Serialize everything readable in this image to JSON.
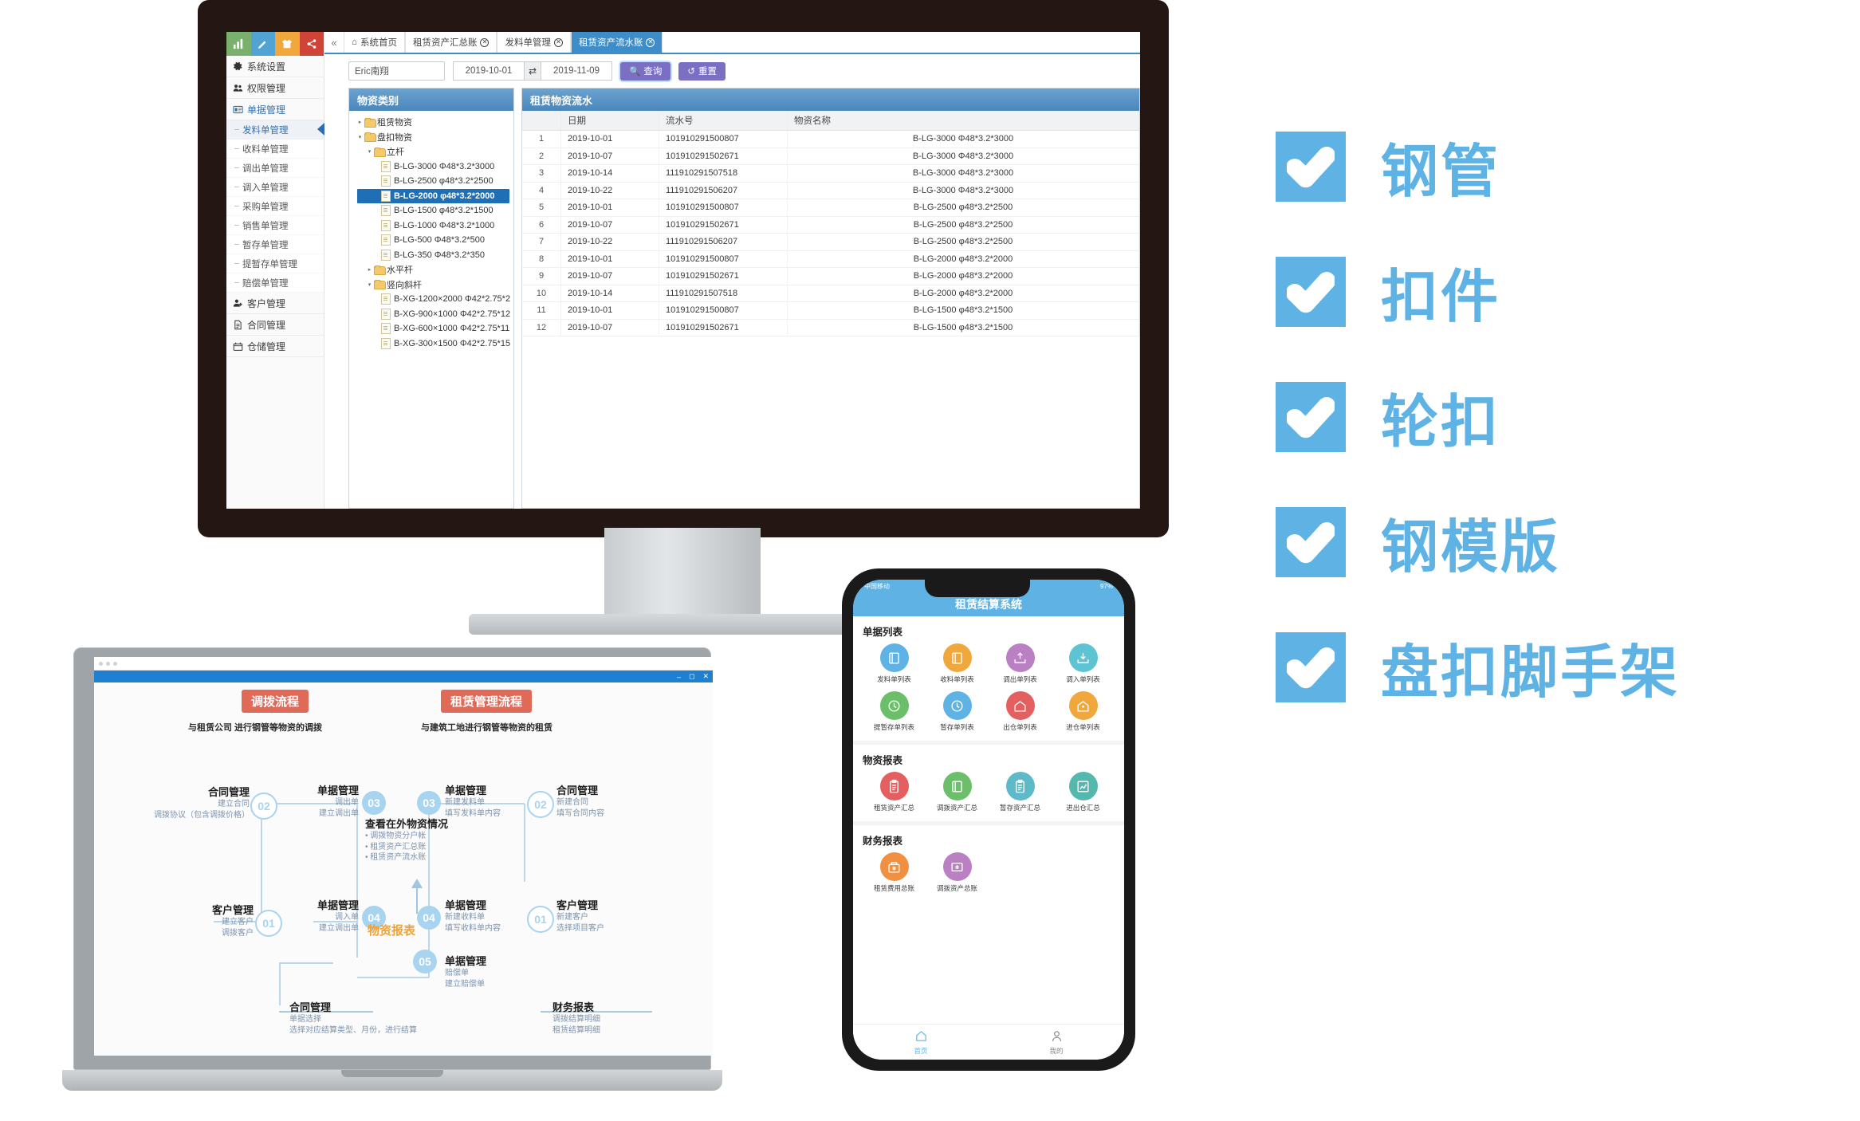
{
  "desktop": {
    "sidebar": {
      "tiles": [
        "chart-icon",
        "pencil-icon",
        "shirt-icon",
        "share-icon"
      ],
      "top_items": [
        {
          "label": "系统设置",
          "icon": "gear-icon"
        },
        {
          "label": "权限管理",
          "icon": "users-icon"
        },
        {
          "label": "单据管理",
          "icon": "card-icon",
          "active": true
        }
      ],
      "sub_items": [
        {
          "label": "发料单管理",
          "selected": true
        },
        {
          "label": "收料单管理"
        },
        {
          "label": "调出单管理"
        },
        {
          "label": "调入单管理"
        },
        {
          "label": "采购单管理"
        },
        {
          "label": "销售单管理"
        },
        {
          "label": "暂存单管理"
        },
        {
          "label": "提暂存单管理"
        },
        {
          "label": "赔偿单管理"
        }
      ],
      "bottom_items": [
        {
          "label": "客户管理",
          "icon": "user-add-icon"
        },
        {
          "label": "合同管理",
          "icon": "document-icon"
        },
        {
          "label": "仓储管理",
          "icon": "warehouse-icon"
        }
      ]
    },
    "tabs": {
      "collapse_icon": "double-chevron-left-icon",
      "items": [
        {
          "label": "系统首页",
          "icon": "home-icon",
          "closable": false,
          "active": false
        },
        {
          "label": "租赁资产汇总账",
          "closable": true,
          "active": false
        },
        {
          "label": "发料单管理",
          "closable": true,
          "active": false
        },
        {
          "label": "租赁资产流水账",
          "closable": true,
          "active": true
        }
      ]
    },
    "filters": {
      "customer_value": "Eric南翔",
      "customer_placeholder": "Eric南翔",
      "date_from": "2019-10-01",
      "swap_icon": "swap-icon",
      "date_to": "2019-11-09",
      "query_label": "查询",
      "query_icon": "search-icon",
      "reset_label": "重置",
      "reset_icon": "refresh-icon"
    },
    "tree_panel": {
      "title": "物资类别",
      "nodes": [
        {
          "label": "租赁物资",
          "type": "folder",
          "depth": 0,
          "state": "collapsed"
        },
        {
          "label": "盘扣物资",
          "type": "folder",
          "depth": 0,
          "state": "expanded"
        },
        {
          "label": "立杆",
          "type": "folder",
          "depth": 1,
          "state": "expanded"
        },
        {
          "label": "B-LG-3000 Φ48*3.2*3000",
          "type": "file",
          "depth": 2
        },
        {
          "label": "B-LG-2500 φ48*3.2*2500",
          "type": "file",
          "depth": 2
        },
        {
          "label": "B-LG-2000 φ48*3.2*2000",
          "type": "file",
          "depth": 2,
          "selected": true
        },
        {
          "label": "B-LG-1500 φ48*3.2*1500",
          "type": "file",
          "depth": 2
        },
        {
          "label": "B-LG-1000 Φ48*3.2*1000",
          "type": "file",
          "depth": 2
        },
        {
          "label": "B-LG-500 Φ48*3.2*500",
          "type": "file",
          "depth": 2
        },
        {
          "label": "B-LG-350 Φ48*3.2*350",
          "type": "file",
          "depth": 2
        },
        {
          "label": "水平杆",
          "type": "folder",
          "depth": 1,
          "state": "collapsed"
        },
        {
          "label": "竖向斜杆",
          "type": "folder",
          "depth": 1,
          "state": "expanded"
        },
        {
          "label": "B-XG-1200×2000 Φ42*2.75*2",
          "type": "file",
          "depth": 2
        },
        {
          "label": "B-XG-900×1000 Φ42*2.75*12",
          "type": "file",
          "depth": 2
        },
        {
          "label": "B-XG-600×1000 Φ42*2.75*11",
          "type": "file",
          "depth": 2
        },
        {
          "label": "B-XG-300×1500 Φ42*2.75*15",
          "type": "file",
          "depth": 2
        }
      ]
    },
    "table_panel": {
      "title": "租赁物资流水",
      "columns": [
        "",
        "日期",
        "流水号",
        "物资名称"
      ],
      "rows": [
        [
          "1",
          "2019-10-01",
          "101910291500807",
          "B-LG-3000 Φ48*3.2*3000"
        ],
        [
          "2",
          "2019-10-07",
          "101910291502671",
          "B-LG-3000 Φ48*3.2*3000"
        ],
        [
          "3",
          "2019-10-14",
          "111910291507518",
          "B-LG-3000 Φ48*3.2*3000"
        ],
        [
          "4",
          "2019-10-22",
          "111910291506207",
          "B-LG-3000 Φ48*3.2*3000"
        ],
        [
          "5",
          "2019-10-01",
          "101910291500807",
          "B-LG-2500 φ48*3.2*2500"
        ],
        [
          "6",
          "2019-10-07",
          "101910291502671",
          "B-LG-2500 φ48*3.2*2500"
        ],
        [
          "7",
          "2019-10-22",
          "111910291506207",
          "B-LG-2500 φ48*3.2*2500"
        ],
        [
          "8",
          "2019-10-01",
          "101910291500807",
          "B-LG-2000 φ48*3.2*2000"
        ],
        [
          "9",
          "2019-10-07",
          "101910291502671",
          "B-LG-2000 φ48*3.2*2000"
        ],
        [
          "10",
          "2019-10-14",
          "111910291507518",
          "B-LG-2000 φ48*3.2*2000"
        ],
        [
          "11",
          "2019-10-01",
          "101910291500807",
          "B-LG-1500 φ48*3.2*1500"
        ],
        [
          "12",
          "2019-10-07",
          "101910291502671",
          "B-LG-1500 φ48*3.2*1500"
        ]
      ]
    }
  },
  "laptop": {
    "flow_left": {
      "badge": "调拨流程",
      "subtitle": "与租赁公司 进行钢管等物资的调拨",
      "n01_title": "客户管理",
      "n01_lines": "建立客户\n调拨客户",
      "n01_num": "01",
      "n02_title": "合同管理",
      "n02_lines": "建立合同\n调拨协议（包含调拨价格）",
      "n02_num": "02",
      "n03_title": "单据管理",
      "n03_lines": "调出单\n建立调出单",
      "n03_num": "03",
      "n04_title": "单据管理",
      "n04_lines": "调入单\n建立调出单",
      "n04_num": "04"
    },
    "flow_center": {
      "title": "查看在外物资情况",
      "bullets": [
        "调拨物资分户帐",
        "租赁资产汇总账",
        "租赁资产流水账"
      ],
      "report_label": "物资报表"
    },
    "flow_right": {
      "badge": "租赁管理流程",
      "subtitle": "与建筑工地进行钢管等物资的租赁",
      "n01_title": "客户管理",
      "n01_lines": "新建客户\n选择项目客户",
      "n01_num": "01",
      "n02_title": "合同管理",
      "n02_lines": "新建合同\n填写合同内容",
      "n02_num": "02",
      "n03_title": "单据管理",
      "n03_lines": "新建发料单\n填写发料单内容",
      "n03_num": "03",
      "n04_title": "单据管理",
      "n04_lines": "新建收料单\n填写收料单内容",
      "n04_num": "04",
      "n05_title": "单据管理",
      "n05_lines": "赔偿单\n建立赔偿单",
      "n05_num": "05"
    },
    "flow_bottom": {
      "contract_title": "合同管理",
      "contract_lines": "单据选择\n选择对应结算类型、月份，进行结算",
      "finance_title": "财务报表",
      "finance_lines": "调拨结算明细\n租赁结算明细"
    }
  },
  "phone": {
    "status_left": "中国移动",
    "status_right": "97%",
    "title": "租赁结算系统",
    "sections": [
      {
        "title": "单据列表",
        "items": [
          {
            "label": "发料单列表",
            "color": "#5eb3e4",
            "icon": "book-icon"
          },
          {
            "label": "收料单列表",
            "color": "#f0a83c",
            "icon": "book-icon"
          },
          {
            "label": "调出单列表",
            "color": "#bb7fc4",
            "icon": "upload-tray-icon"
          },
          {
            "label": "调入单列表",
            "color": "#5ec4d4",
            "icon": "download-tray-icon"
          },
          {
            "label": "提暂存单列表",
            "color": "#6cbf6a",
            "icon": "clock-icon"
          },
          {
            "label": "暂存单列表",
            "color": "#5eb3e4",
            "icon": "clock-icon"
          },
          {
            "label": "出仓单列表",
            "color": "#e45f5f",
            "icon": "house-icon"
          },
          {
            "label": "进仓单列表",
            "color": "#f0a83c",
            "icon": "house-plus-icon"
          }
        ]
      },
      {
        "title": "物资报表",
        "items": [
          {
            "label": "租赁资产汇总",
            "color": "#e45f5f",
            "icon": "clipboard-icon"
          },
          {
            "label": "调拨资产汇总",
            "color": "#6cbf6a",
            "icon": "book-icon"
          },
          {
            "label": "暂存资产汇总",
            "color": "#5ebac9",
            "icon": "clipboard-icon"
          },
          {
            "label": "进出仓汇总",
            "color": "#55b8ae",
            "icon": "chart-icon"
          }
        ]
      },
      {
        "title": "财务报表",
        "items": [
          {
            "label": "租赁费用总账",
            "color": "#f09040",
            "icon": "money-box-icon"
          },
          {
            "label": "调拨资产总账",
            "color": "#bb7fc4",
            "icon": "money-note-icon"
          }
        ]
      }
    ],
    "tabs": [
      {
        "label": "首页",
        "icon": "home-icon",
        "active": true
      },
      {
        "label": "我的",
        "icon": "person-icon",
        "active": false
      }
    ]
  },
  "checklist": {
    "accent": "#5eb3e4",
    "items": [
      {
        "label": "钢管"
      },
      {
        "label": "扣件"
      },
      {
        "label": "轮扣"
      },
      {
        "label": "钢模版"
      },
      {
        "label": "盘扣脚手架"
      }
    ]
  }
}
